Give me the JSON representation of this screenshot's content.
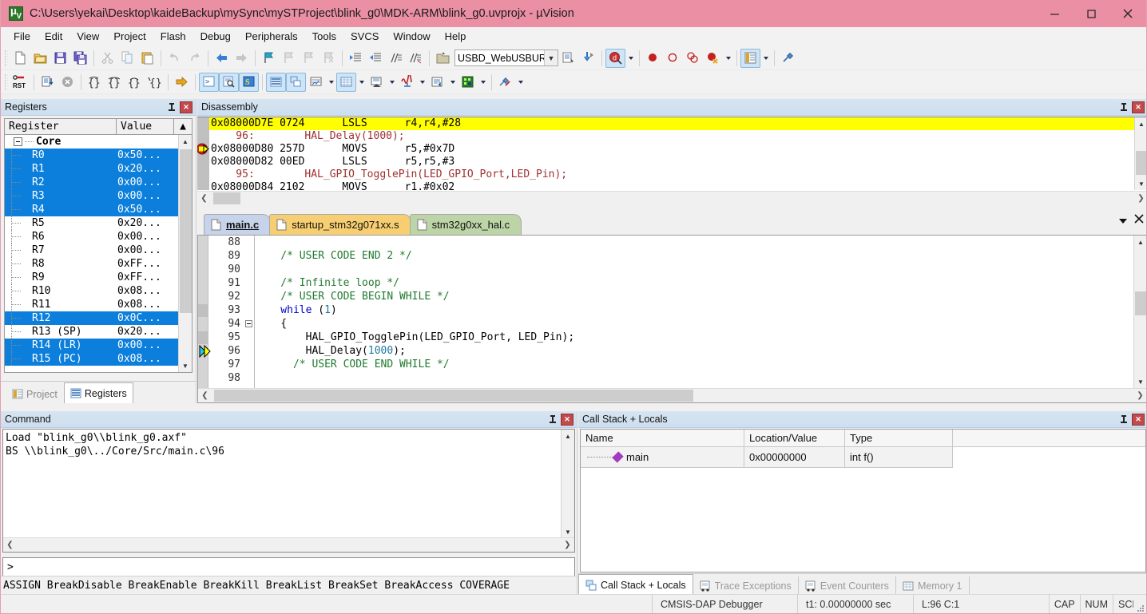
{
  "window": {
    "title": "C:\\Users\\yekai\\Desktop\\kaideBackup\\mySync\\mySTProject\\blink_g0\\MDK-ARM\\blink_g0.uvprojx - µVision",
    "titlebar_color": "#eb8fa4",
    "app_icon": "uvision-logo-icon",
    "minimize": "–",
    "maximize": "☐",
    "close": "✕"
  },
  "menu": {
    "items": [
      {
        "label": "File"
      },
      {
        "label": "Edit"
      },
      {
        "label": "View"
      },
      {
        "label": "Project"
      },
      {
        "label": "Flash"
      },
      {
        "label": "Debug"
      },
      {
        "label": "Peripherals"
      },
      {
        "label": "Tools"
      },
      {
        "label": "SVCS"
      },
      {
        "label": "Window"
      },
      {
        "label": "Help"
      }
    ]
  },
  "toolbar_main": {
    "target_combo": {
      "value": "USBD_WebUSBURLD",
      "placeholder": "Select Target"
    },
    "buttons": [
      {
        "name": "new-file-icon"
      },
      {
        "name": "open-file-icon"
      },
      {
        "name": "save-icon"
      },
      {
        "name": "save-all-icon"
      },
      {
        "name": "cut-icon"
      },
      {
        "name": "copy-icon"
      },
      {
        "name": "paste-icon"
      },
      {
        "name": "undo-icon"
      },
      {
        "name": "redo-icon"
      },
      {
        "name": "navigate-back-icon"
      },
      {
        "name": "navigate-forward-icon"
      },
      {
        "name": "bookmark-toggle-icon"
      },
      {
        "name": "bookmark-prev-icon"
      },
      {
        "name": "bookmark-next-icon"
      },
      {
        "name": "bookmark-clear-icon"
      },
      {
        "name": "indent-icon"
      },
      {
        "name": "outdent-icon"
      },
      {
        "name": "comment-icon"
      },
      {
        "name": "uncomment-icon"
      },
      {
        "name": "build-target-icon"
      },
      {
        "name": "batch-build-icon"
      },
      {
        "name": "download-icon"
      },
      {
        "name": "start-debug-icon"
      },
      {
        "name": "insert-breakpoint-icon"
      },
      {
        "name": "disable-breakpoint-icon"
      },
      {
        "name": "disable-all-breakpoints-icon"
      },
      {
        "name": "kill-all-breakpoints-icon"
      },
      {
        "name": "manage-components-icon"
      },
      {
        "name": "configuration-wizard-icon"
      }
    ]
  },
  "toolbar_debug": {
    "buttons": [
      {
        "name": "reset-cpu-icon"
      },
      {
        "name": "run-icon"
      },
      {
        "name": "stop-icon"
      },
      {
        "name": "step-icon"
      },
      {
        "name": "step-over-icon"
      },
      {
        "name": "step-out-icon"
      },
      {
        "name": "run-to-cursor-icon"
      },
      {
        "name": "show-current-statement-icon"
      },
      {
        "name": "command-window-icon"
      },
      {
        "name": "disassembly-window-icon"
      },
      {
        "name": "symbols-window-icon"
      },
      {
        "name": "registers-window-icon"
      },
      {
        "name": "call-stack-window-icon"
      },
      {
        "name": "watch-window-icon"
      },
      {
        "name": "memory-window-icon"
      },
      {
        "name": "serial-window-icon"
      },
      {
        "name": "analysis-window-icon"
      },
      {
        "name": "trace-window-icon"
      },
      {
        "name": "system-viewer-icon"
      },
      {
        "name": "toolbox-icon"
      }
    ]
  },
  "registers_panel": {
    "title": "Registers",
    "pin_icon": "pin-icon",
    "close_icon": "close-icon",
    "columns": [
      "Register",
      "Value"
    ],
    "root": "Core",
    "rows": [
      {
        "name": "R0",
        "value": "0x50...",
        "selected": true
      },
      {
        "name": "R1",
        "value": "0x20...",
        "selected": true
      },
      {
        "name": "R2",
        "value": "0x00...",
        "selected": true
      },
      {
        "name": "R3",
        "value": "0x00...",
        "selected": true
      },
      {
        "name": "R4",
        "value": "0x50...",
        "selected": true
      },
      {
        "name": "R5",
        "value": "0x20...",
        "selected": false
      },
      {
        "name": "R6",
        "value": "0x00...",
        "selected": false
      },
      {
        "name": "R7",
        "value": "0x00...",
        "selected": false
      },
      {
        "name": "R8",
        "value": "0xFF...",
        "selected": false
      },
      {
        "name": "R9",
        "value": "0xFF...",
        "selected": false
      },
      {
        "name": "R10",
        "value": "0x08...",
        "selected": false
      },
      {
        "name": "R11",
        "value": "0x08...",
        "selected": false
      },
      {
        "name": "R12",
        "value": "0x0C...",
        "selected": true
      },
      {
        "name": "R13 (SP)",
        "value": "0x20...",
        "selected": false
      },
      {
        "name": "R14 (LR)",
        "value": "0x00...",
        "selected": true
      },
      {
        "name": "R15 (PC)",
        "value": "0x08...",
        "selected": true
      }
    ],
    "tabs": [
      {
        "label": "Project",
        "icon": "project-icon",
        "active": false
      },
      {
        "label": "Registers",
        "icon": "registers-icon",
        "active": true
      }
    ]
  },
  "disassembly_panel": {
    "title": "Disassembly",
    "pin_icon": "pin-icon",
    "close_icon": "close-icon",
    "lines": [
      {
        "kind": "asm",
        "text": "0x08000D7E 0724      LSLS      r4,r4,#28",
        "highlight": true,
        "marker": ""
      },
      {
        "kind": "src",
        "text": "    96:        HAL_Delay(1000);",
        "highlight": false,
        "marker": ""
      },
      {
        "kind": "asm",
        "text": "0x08000D80 257D      MOVS      r5,#0x7D",
        "highlight": false,
        "marker": "breakpoint-arrow"
      },
      {
        "kind": "asm",
        "text": "0x08000D82 00ED      LSLS      r5,r5,#3",
        "highlight": false,
        "marker": ""
      },
      {
        "kind": "src",
        "text": "    95:        HAL_GPIO_TogglePin(LED_GPIO_Port,LED_Pin);",
        "highlight": false,
        "marker": ""
      },
      {
        "kind": "asm",
        "text": "0x08000D84 2102      MOVS      r1,#0x02",
        "highlight": false,
        "marker": ""
      }
    ]
  },
  "editor": {
    "tabs": [
      {
        "label": "main.c",
        "icon": "file-icon",
        "style": "t-main",
        "active": true
      },
      {
        "label": "startup_stm32g071xx.s",
        "icon": "file-icon",
        "style": "t-startup",
        "active": false
      },
      {
        "label": "stm32g0xx_hal.c",
        "icon": "file-icon",
        "style": "t-hal",
        "active": false
      }
    ],
    "tab_menu_icon": "chevron-down-icon",
    "tab_close_icon": "close-icon",
    "first_line_number": 88,
    "lines": [
      {
        "num": 88,
        "segments": []
      },
      {
        "num": 89,
        "segments": [
          {
            "cls": "c-com",
            "t": "    /* USER CODE END 2 */"
          }
        ]
      },
      {
        "num": 90,
        "segments": []
      },
      {
        "num": 91,
        "segments": [
          {
            "cls": "c-com",
            "t": "    /* Infinite loop */"
          }
        ]
      },
      {
        "num": 92,
        "segments": [
          {
            "cls": "c-com",
            "t": "    /* USER CODE BEGIN WHILE */"
          }
        ]
      },
      {
        "num": 93,
        "segments": [
          {
            "cls": "c-kw",
            "t": "    while"
          },
          {
            "cls": "c-txt",
            "t": " ("
          },
          {
            "cls": "c-num",
            "t": "1"
          },
          {
            "cls": "c-txt",
            "t": ")"
          }
        ]
      },
      {
        "num": 94,
        "segments": [
          {
            "cls": "c-txt",
            "t": "    {"
          }
        ],
        "fold": true
      },
      {
        "num": 95,
        "segments": [
          {
            "cls": "c-txt",
            "t": "        HAL_GPIO_TogglePin(LED_GPIO_Port, LED_Pin);"
          }
        ]
      },
      {
        "num": 96,
        "segments": [
          {
            "cls": "c-txt",
            "t": "        HAL_Delay("
          },
          {
            "cls": "c-num",
            "t": "1000"
          },
          {
            "cls": "c-txt",
            "t": ");"
          }
        ],
        "marker": "current-statement-arrow"
      },
      {
        "num": 97,
        "segments": [
          {
            "cls": "c-com",
            "t": "      /* USER CODE END WHILE */"
          }
        ]
      },
      {
        "num": 98,
        "segments": []
      }
    ]
  },
  "command_panel": {
    "title": "Command",
    "pin_icon": "pin-icon",
    "close_icon": "close-icon",
    "output": [
      "Load \"blink_g0\\\\blink_g0.axf\"",
      "BS \\\\blink_g0\\../Core/Src/main.c\\96"
    ],
    "input_prompt": ">",
    "input_value": "",
    "keyword_bar": "ASSIGN BreakDisable BreakEnable BreakKill BreakList BreakSet BreakAccess COVERAGE"
  },
  "callstack_panel": {
    "title": "Call Stack + Locals",
    "pin_icon": "pin-icon",
    "close_icon": "close-icon",
    "columns": [
      "Name",
      "Location/Value",
      "Type"
    ],
    "rows": [
      {
        "name": "main",
        "location": "0x00000000",
        "type": "int f()"
      }
    ],
    "tabs": [
      {
        "label": "Call Stack + Locals",
        "icon": "call-stack-icon",
        "active": true
      },
      {
        "label": "Trace Exceptions",
        "icon": "trace-icon",
        "active": false
      },
      {
        "label": "Event Counters",
        "icon": "event-counter-icon",
        "active": false
      },
      {
        "label": "Memory 1",
        "icon": "memory-icon",
        "active": false
      }
    ]
  },
  "status_bar": {
    "debugger": "CMSIS-DAP Debugger",
    "time": "t1: 0.00000000 sec",
    "cursor": "L:96 C:1",
    "caps": "CAP",
    "num": "NUM",
    "scrl": "SCRL"
  },
  "colors": {
    "title_bar": "#eb8fa4",
    "highlight_line": "#ffff00",
    "selection": "#0b7fdb",
    "comment": "#1f7a2e",
    "keyword": "#0000d0",
    "asm_source": "#a03030"
  }
}
